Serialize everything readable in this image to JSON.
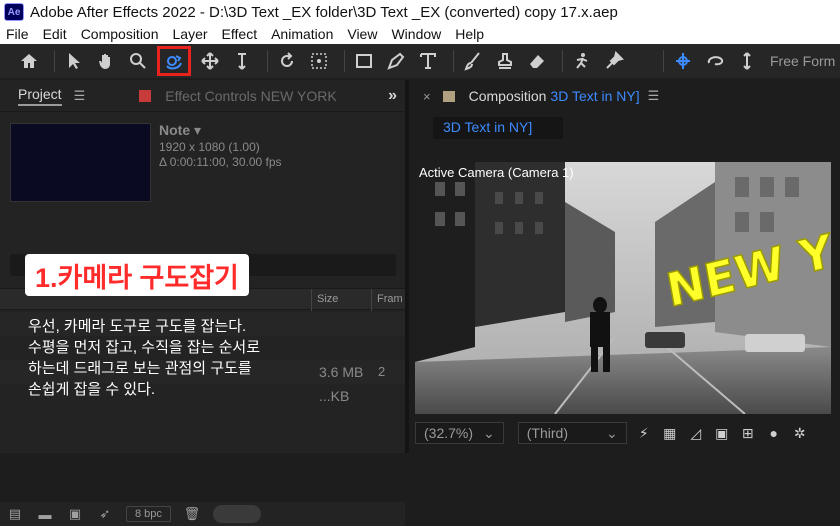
{
  "window": {
    "title": "Adobe After Effects 2022 - D:\\3D Text _EX folder\\3D Text _EX (converted) copy 17.x.aep",
    "logo": "Ae"
  },
  "menu": [
    "File",
    "Edit",
    "Composition",
    "Layer",
    "Effect",
    "Animation",
    "View",
    "Window",
    "Help"
  ],
  "toolbar": {
    "icons": [
      "home-icon",
      "selection-icon",
      "hand-icon",
      "zoom-icon",
      "orbit-camera-icon",
      "track-xy-camera-icon",
      "track-z-camera-icon",
      "rotate-icon",
      "anchor-icon",
      "rectangle-icon",
      "pen-icon",
      "type-icon",
      "brush-icon",
      "clone-stamp-icon",
      "eraser-icon",
      "roto-brush-icon",
      "puppet-pin-icon"
    ],
    "active_tool": "orbit-camera-icon",
    "highlight_color": "#e8231d",
    "free_form_label": "Free Form"
  },
  "project_panel": {
    "tab_label": "Project",
    "effect_controls_label": "Effect Controls NEW YORK",
    "note": {
      "title": "Note ▾",
      "dimensions": "1920 x 1080 (1.00)",
      "duration": "Δ 0:00:11:00, 30.00 fps"
    },
    "columns": {
      "size": "Size",
      "frame": "Fram"
    },
    "rows": [
      {
        "size": "",
        "edge": ""
      },
      {
        "size": "",
        "edge": ""
      },
      {
        "size": "3.6 MB",
        "edge": "2"
      },
      {
        "size": "...KB",
        "edge": ""
      }
    ],
    "bpc_label": "8 bpc"
  },
  "overlay": {
    "title": "1.카메라 구도잡기",
    "title_color": "#ff2a2a",
    "lines": [
      "우선, 카메라 도구로 구도를 잡는다.",
      "수평을 먼저 잡고, 수직을 잡는 순서로",
      "하는데 드래그로 보는 관점의 구도를",
      "손쉽게 잡을 수 있다."
    ]
  },
  "composition_panel": {
    "tab_prefix": "Composition",
    "comp_name": "3D Text in NY]",
    "breadcrumb": "3D Text in NY]",
    "viewer_label": "Active Camera (Camera 1)",
    "scene_text": "NEW YORK",
    "scene_text_color": "#ffff2a",
    "zoom": "(32.7%)",
    "resolution": "(Third)",
    "accent_color": "#3d8bff"
  }
}
